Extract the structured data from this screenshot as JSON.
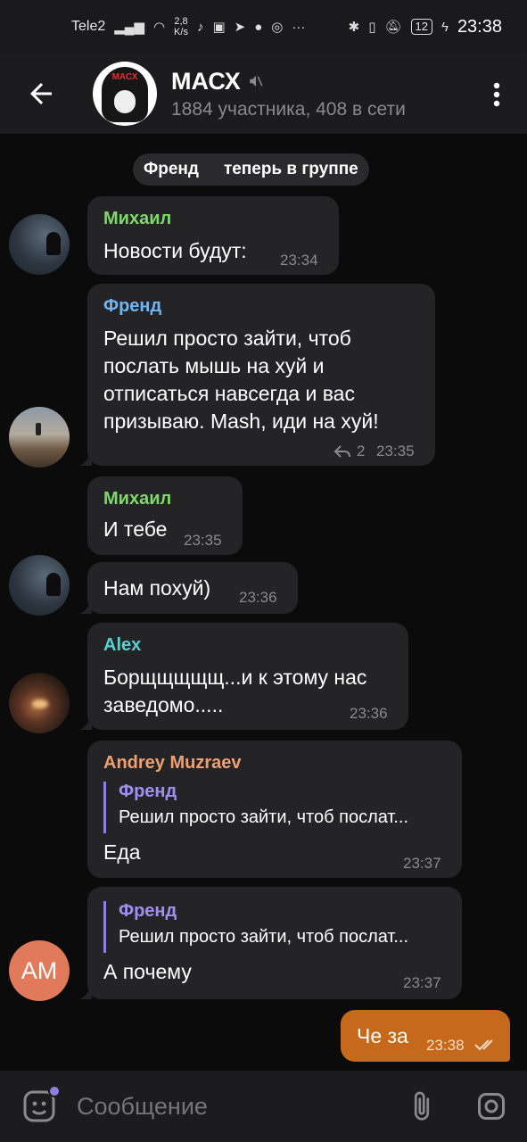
{
  "status_bar": {
    "carrier": "Tele2",
    "net_speed_value": "2,8",
    "net_speed_unit": "K/s",
    "battery": "12",
    "time": "23:38"
  },
  "header": {
    "title": "МАСХ",
    "subtitle": "1884 участника, 408 в сети",
    "avatar_label": "МАСХ"
  },
  "chat": {
    "service_message": {
      "name": "Френд",
      "text": "теперь в группе"
    },
    "messages": [
      {
        "sender": "Михаил",
        "text": "Новости будут:",
        "time": "23:34"
      },
      {
        "sender": "Френд",
        "lines": [
          "Решил просто зайти, чтоб",
          "послать мышь на хуй и",
          "отписаться навсегда и вас",
          "призываю. Mash, иди на хуй!"
        ],
        "replies_count": "2",
        "time": "23:35"
      },
      {
        "sender": "Михаил",
        "text": "И тебе",
        "time": "23:35"
      },
      {
        "text": "Нам похуй)",
        "time": "23:36"
      },
      {
        "sender": "Alex",
        "lines": [
          "Борщщщщщ...и к этому нас",
          "заведомо....."
        ],
        "time": "23:36"
      },
      {
        "sender": "Andrey Muzraev",
        "reply_to": "Френд",
        "reply_text": "Решил просто зайти, чтоб послат...",
        "text": "Еда",
        "time": "23:37"
      },
      {
        "reply_to": "Френд",
        "reply_text": "Решил просто зайти, чтоб послат...",
        "text": "А почему",
        "time": "23:37"
      },
      {
        "text": "Че за",
        "time": "23:38",
        "outgoing": true
      }
    ],
    "avatar_initials_am": "AM"
  },
  "input_bar": {
    "placeholder": "Сообщение"
  },
  "colors": {
    "mikhail": "#7fd96b",
    "frend": "#6fb6f2",
    "alex": "#56d2d2",
    "andrey": "#f0a070",
    "outgoing_bubble": "#c56a1c",
    "incoming_bubble": "#242426",
    "accent": "#8f7fe0"
  },
  "icons": [
    "back-arrow-icon",
    "mute-icon",
    "more-vert-icon",
    "reply-icon",
    "read-checks-icon",
    "emoji-icon",
    "attach-icon",
    "camera-icon"
  ]
}
